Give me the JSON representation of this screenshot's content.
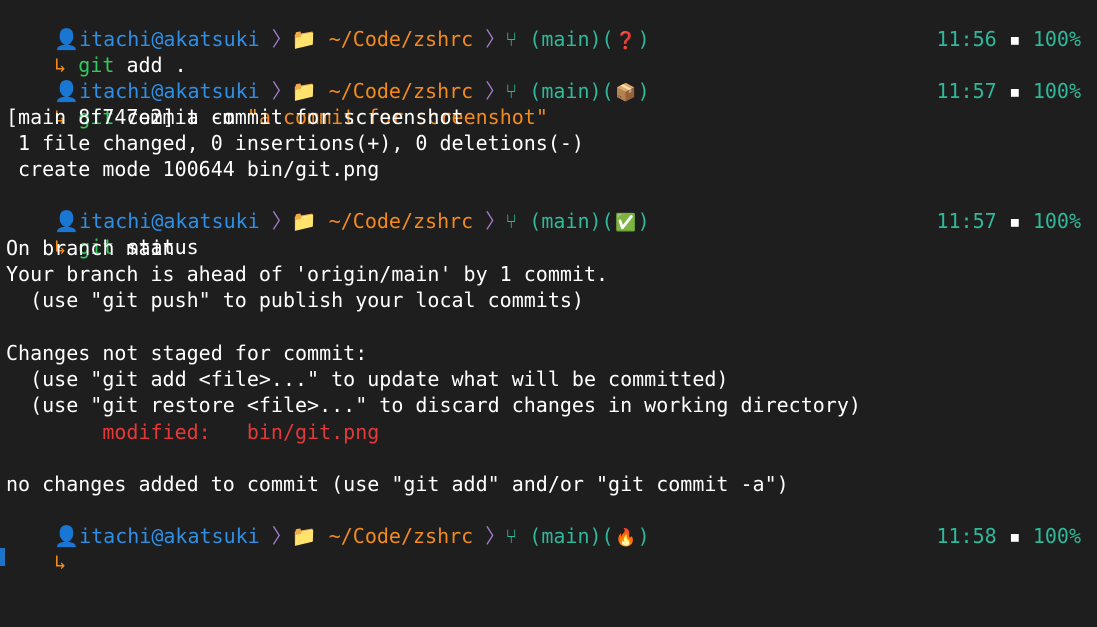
{
  "prompt": {
    "user": "itachi@akatsuki",
    "dir": "~/Code/zshrc",
    "branch_text": "(main)(",
    "branch_close": ")"
  },
  "status_glyphs": [
    "❓",
    "📦",
    "✅",
    "🔥"
  ],
  "rights": [
    {
      "time": "11:56",
      "dot": "▪",
      "battery": "100%"
    },
    {
      "time": "11:57",
      "dot": "▪",
      "battery": "100%"
    },
    {
      "time": "11:57",
      "dot": "▪",
      "battery": "100%"
    },
    {
      "time": "11:58",
      "dot": "▪",
      "battery": "100%"
    }
  ],
  "cmd_arrow": "↳",
  "commands": {
    "c1_git": "git",
    "c1_rest": "add .",
    "c2_git": "git",
    "c2_rest": "commit -m ",
    "c2_str": "\"a commit for screenshot\"",
    "c3_git": "git",
    "c3_rest": "status"
  },
  "output": {
    "o1": "[main 8f747e2] a commit for screenshot",
    "o2": " 1 file changed, 0 insertions(+), 0 deletions(-)",
    "o3": " create mode 100644 bin/git.png",
    "o4": "On branch main",
    "o5": "Your branch is ahead of 'origin/main' by 1 commit.",
    "o6": "  (use \"git push\" to publish your local commits)",
    "o7": "Changes not staged for commit:",
    "o8": "  (use \"git add <file>...\" to update what will be committed)",
    "o9": "  (use \"git restore <file>...\" to discard changes in working directory)",
    "o10_label": "        modified:   ",
    "o10_file": "bin/git.png",
    "o11": "no changes added to commit (use \"git add\" and/or \"git commit -a\")"
  }
}
